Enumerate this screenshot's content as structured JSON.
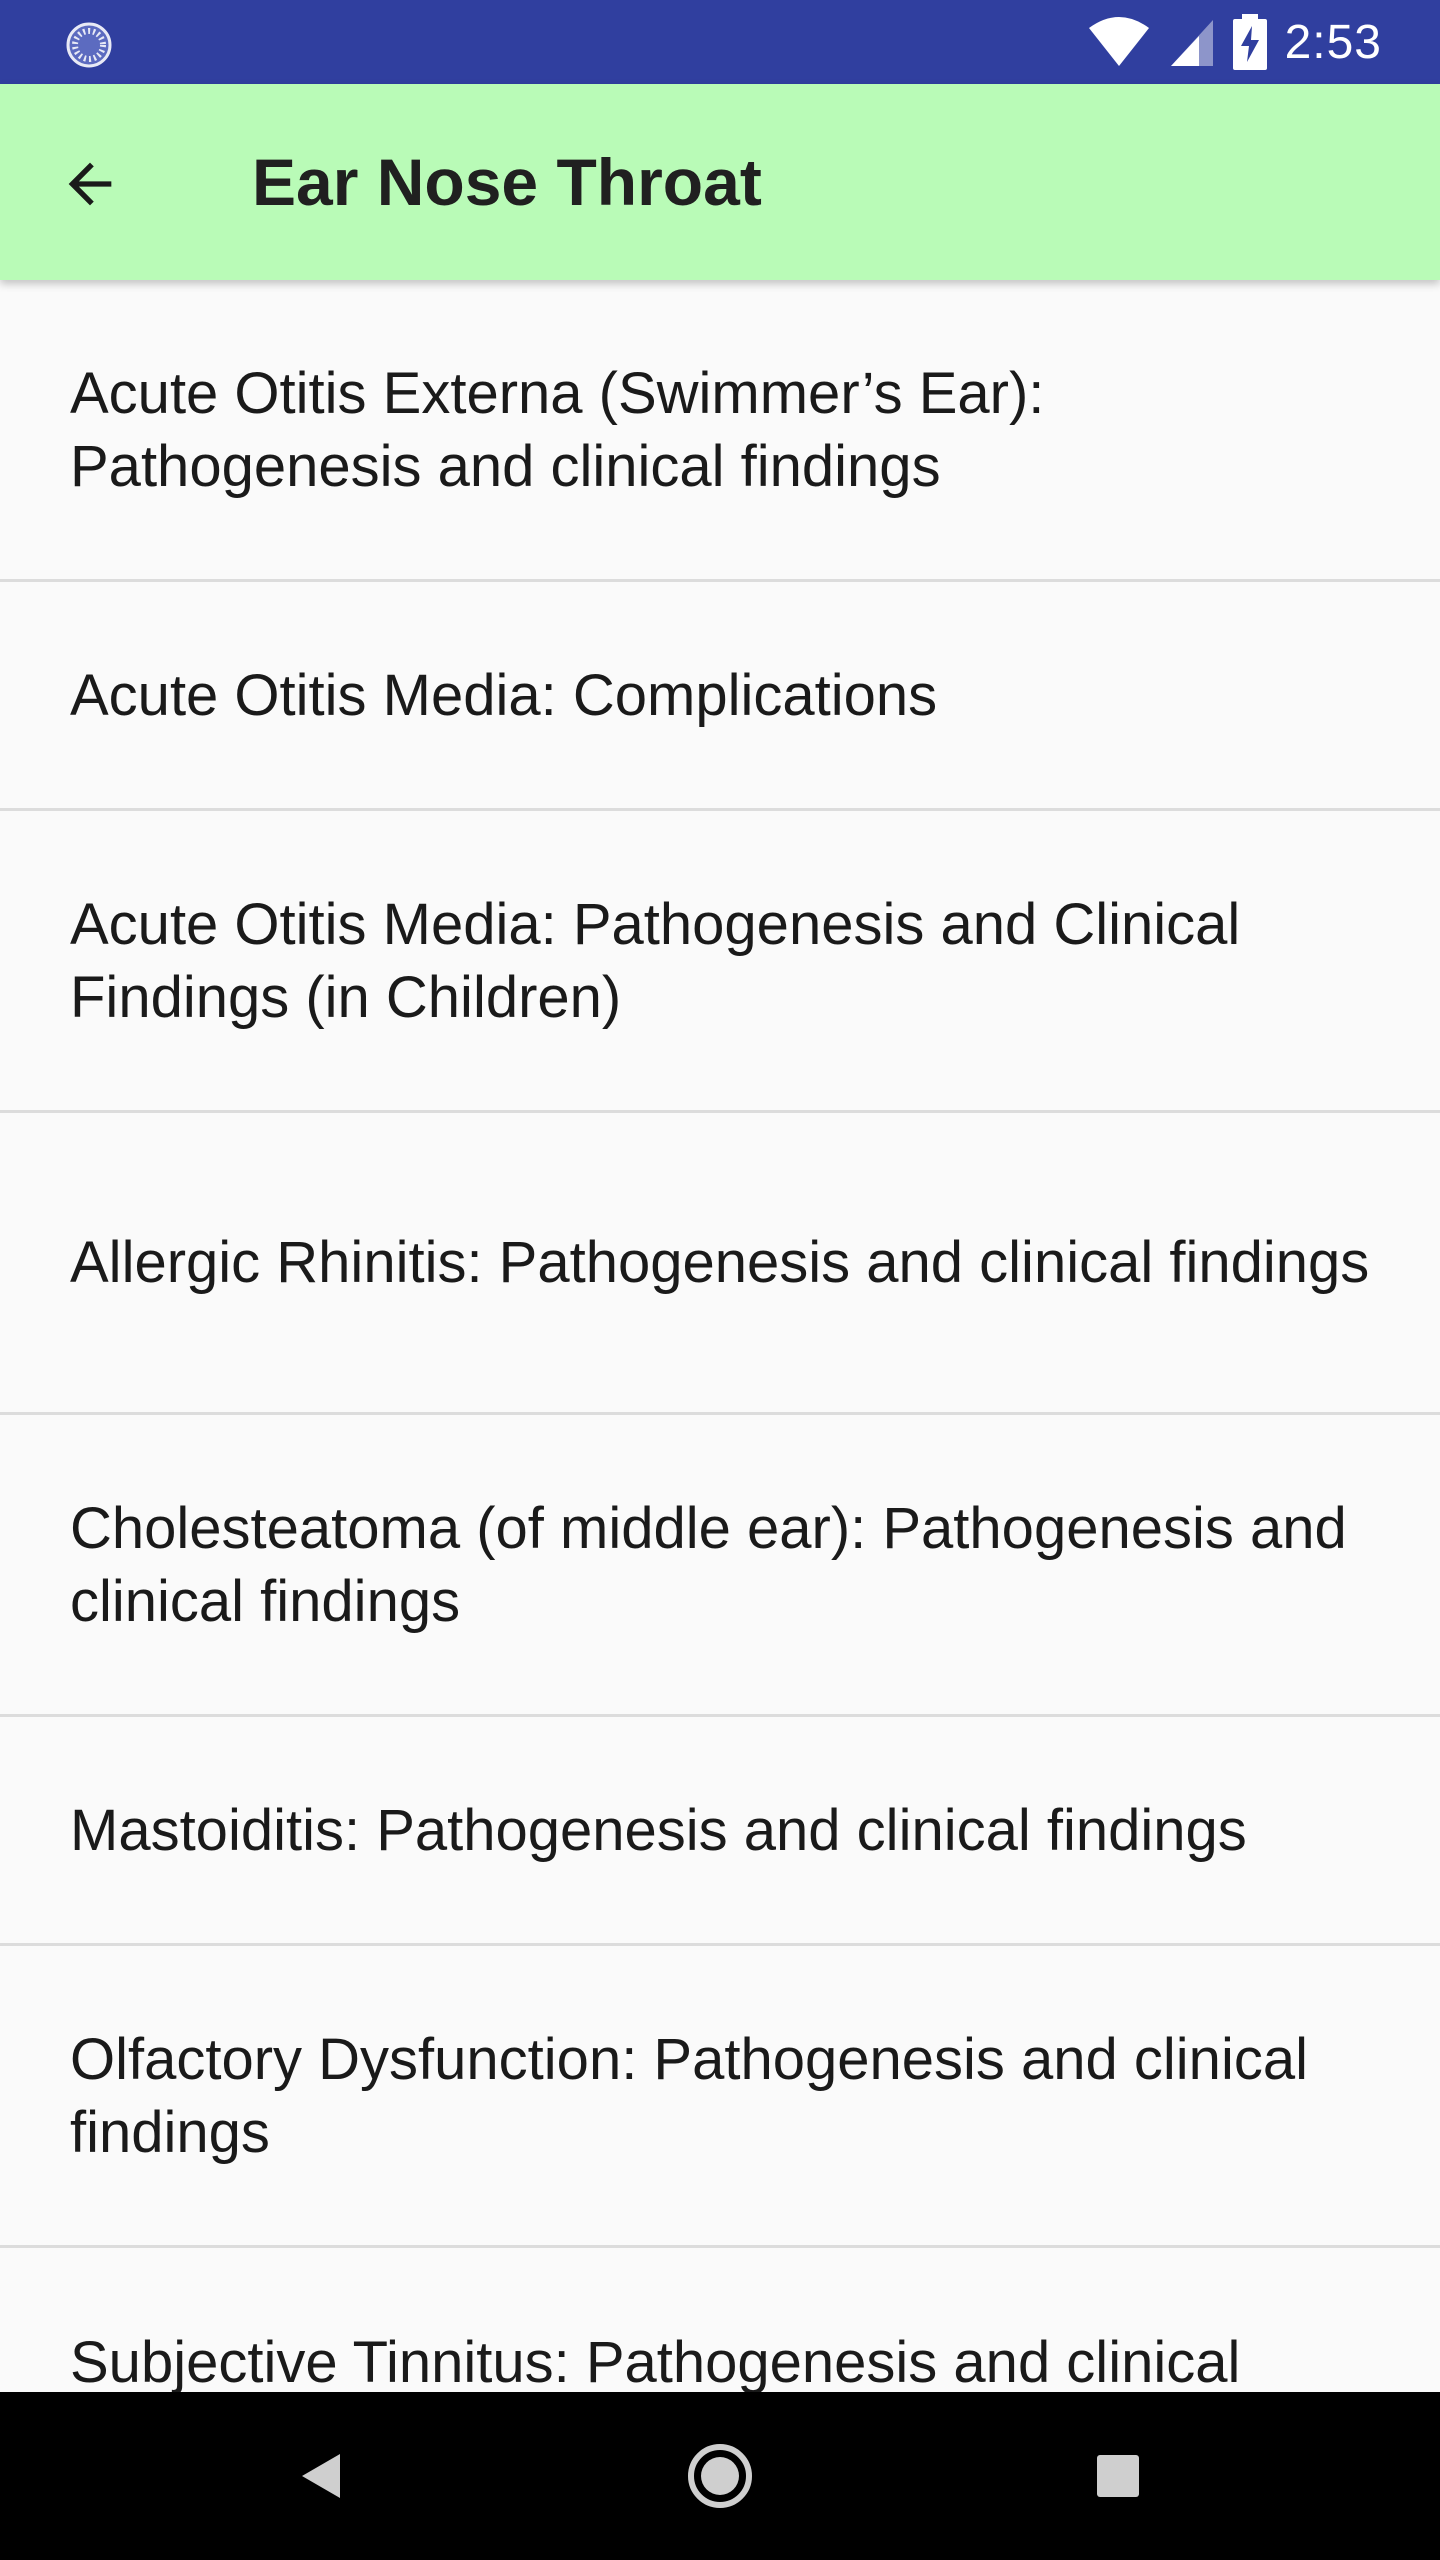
{
  "status_bar": {
    "time": "2:53",
    "icons": [
      "loading-spinner-icon",
      "wifi-icon",
      "cellular-signal-icon",
      "battery-charging-icon"
    ],
    "background_color": "#303f9f"
  },
  "app_bar": {
    "title": "Ear Nose Throat",
    "back_icon": "arrow-back-icon",
    "background_color": "#b9fbb7"
  },
  "topics": [
    {
      "label": "Acute Otitis Externa (Swimmer’s Ear): Pathogenesis and clinical findings"
    },
    {
      "label": "Acute Otitis Media: Complications"
    },
    {
      "label": "Acute Otitis Media: Pathogenesis and Clinical Findings (in Children)"
    },
    {
      "label": "Allergic Rhinitis: Pathogenesis and clinical findings"
    },
    {
      "label": "Cholesteatoma (of middle ear): Pathogenesis and clinical findings"
    },
    {
      "label": "Mastoiditis: Pathogenesis and clinical findings"
    },
    {
      "label": "Olfactory Dysfunction: Pathogenesis and clinical findings"
    },
    {
      "label": "Subjective Tinnitus: Pathogenesis and clinical findings"
    }
  ],
  "nav_bar": {
    "icons": [
      "back-triangle-icon",
      "home-circle-icon",
      "recents-square-icon"
    ]
  }
}
